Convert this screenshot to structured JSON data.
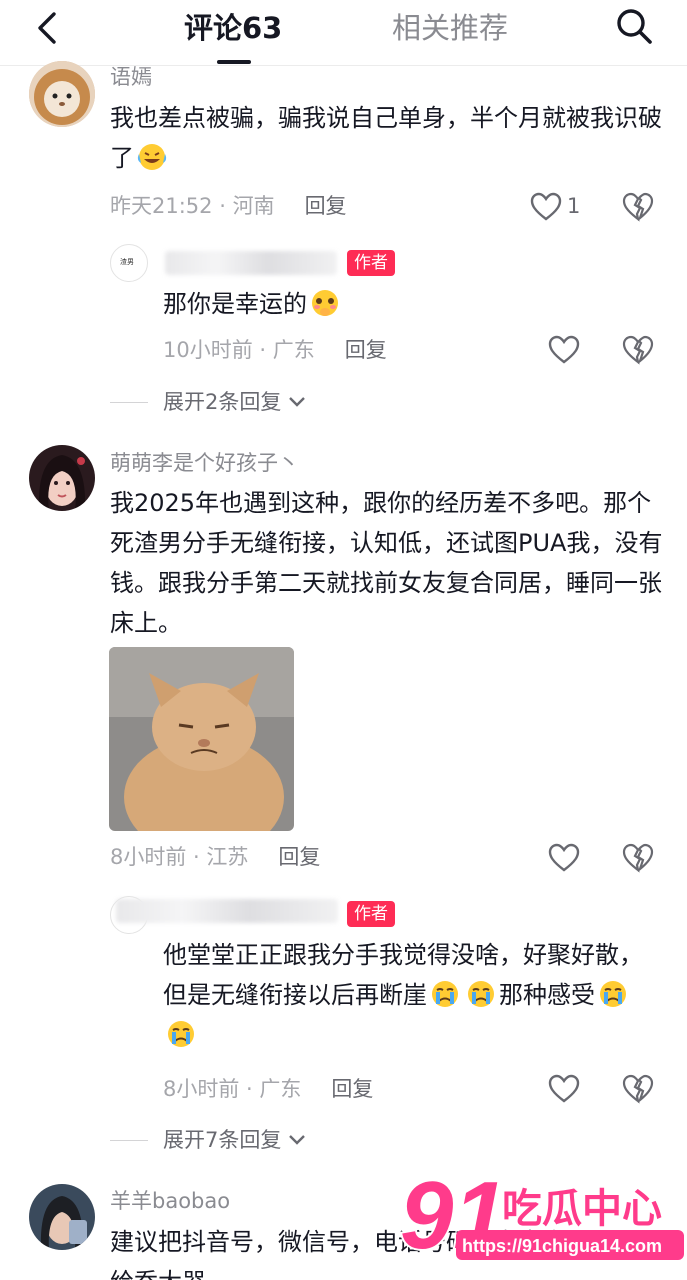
{
  "header": {
    "comments_tab": "评论63",
    "related_tab": "相关推荐"
  },
  "comments": [
    {
      "name": "语嫣",
      "text": "我也差点被骗，骗我说自己单身，半个月就被我识破了",
      "time": "昨天21:52",
      "location": "河南",
      "reply_label": "回复",
      "likes": "1"
    },
    {
      "name": "萌萌李是个好孩子丶",
      "text": "我2025年也遇到这种，跟你的经历差不多吧。那个死渣男分手无缝衔接，认知低，还试图PUA我，没有钱。跟我分手第二天就找前女友复合同居，睡同一张床上。",
      "time": "8小时前",
      "location": "江苏",
      "reply_label": "回复"
    },
    {
      "name": "羊羊baobao",
      "text_line1": "建议把抖音号，微信号，电话号码，发出来",
      "text_line2": "给乔大器"
    }
  ],
  "replies": [
    {
      "badge": "作者",
      "text": "那你是幸运的",
      "time": "10小时前",
      "location": "广东",
      "reply_label": "回复",
      "avatar_text": "渣男"
    },
    {
      "badge": "作者",
      "text_a": "他堂堂正正跟我分手我觉得没啥，好聚好散，但是无缝衔接以后再断崖",
      "text_b": "那种感受",
      "time": "8小时前",
      "location": "广东",
      "reply_label": "回复"
    }
  ],
  "expand_1": "展开2条回复",
  "expand_2": "展开7条回复",
  "watermark": {
    "number": "91",
    "brand": "吃瓜中心",
    "url": "https://91chigua14.com"
  },
  "colors": {
    "badge": "#fe2c55",
    "watermark": "#ff3b8b"
  }
}
